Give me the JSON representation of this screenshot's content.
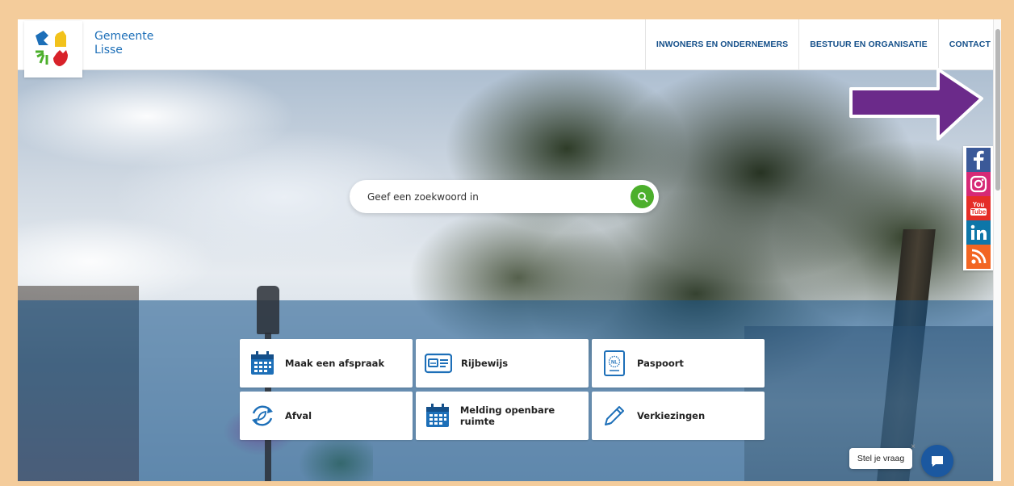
{
  "header": {
    "brand_line1": "Gemeente",
    "brand_line2": "Lisse",
    "nav": [
      {
        "label": "INWONERS EN ONDERNEMERS"
      },
      {
        "label": "BESTUUR EN ORGANISATIE"
      },
      {
        "label": "CONTACT"
      }
    ]
  },
  "search": {
    "placeholder": "Geef een zoekwoord in",
    "icon": "search-icon"
  },
  "social": [
    {
      "name": "facebook-icon",
      "color": "#3b5998"
    },
    {
      "name": "instagram-icon",
      "color": "#d62976"
    },
    {
      "name": "youtube-icon",
      "color": "#e52d27",
      "text_top": "You",
      "text_bottom": "Tube"
    },
    {
      "name": "linkedin-icon",
      "color": "#0e76a8"
    },
    {
      "name": "rss-icon",
      "color": "#f26522"
    }
  ],
  "tiles": [
    {
      "label": "Maak een afspraak",
      "icon": "calendar-icon"
    },
    {
      "label": "Rijbewijs",
      "icon": "drivers-license-icon"
    },
    {
      "label": "Paspoort",
      "icon": "passport-icon"
    },
    {
      "label": "Afval",
      "icon": "recycle-icon"
    },
    {
      "label": "Melding openbare ruimte",
      "icon": "calendar-icon"
    },
    {
      "label": "Verkiezingen",
      "icon": "pencil-icon"
    }
  ],
  "chat": {
    "prompt": "Stel je vraag",
    "close": "×"
  },
  "passport_badge": "NL",
  "colors": {
    "brand_blue": "#1d6fb8",
    "nav_blue": "#15508a",
    "search_green": "#4caf2c",
    "arrow_purple": "#6b2a8a"
  }
}
